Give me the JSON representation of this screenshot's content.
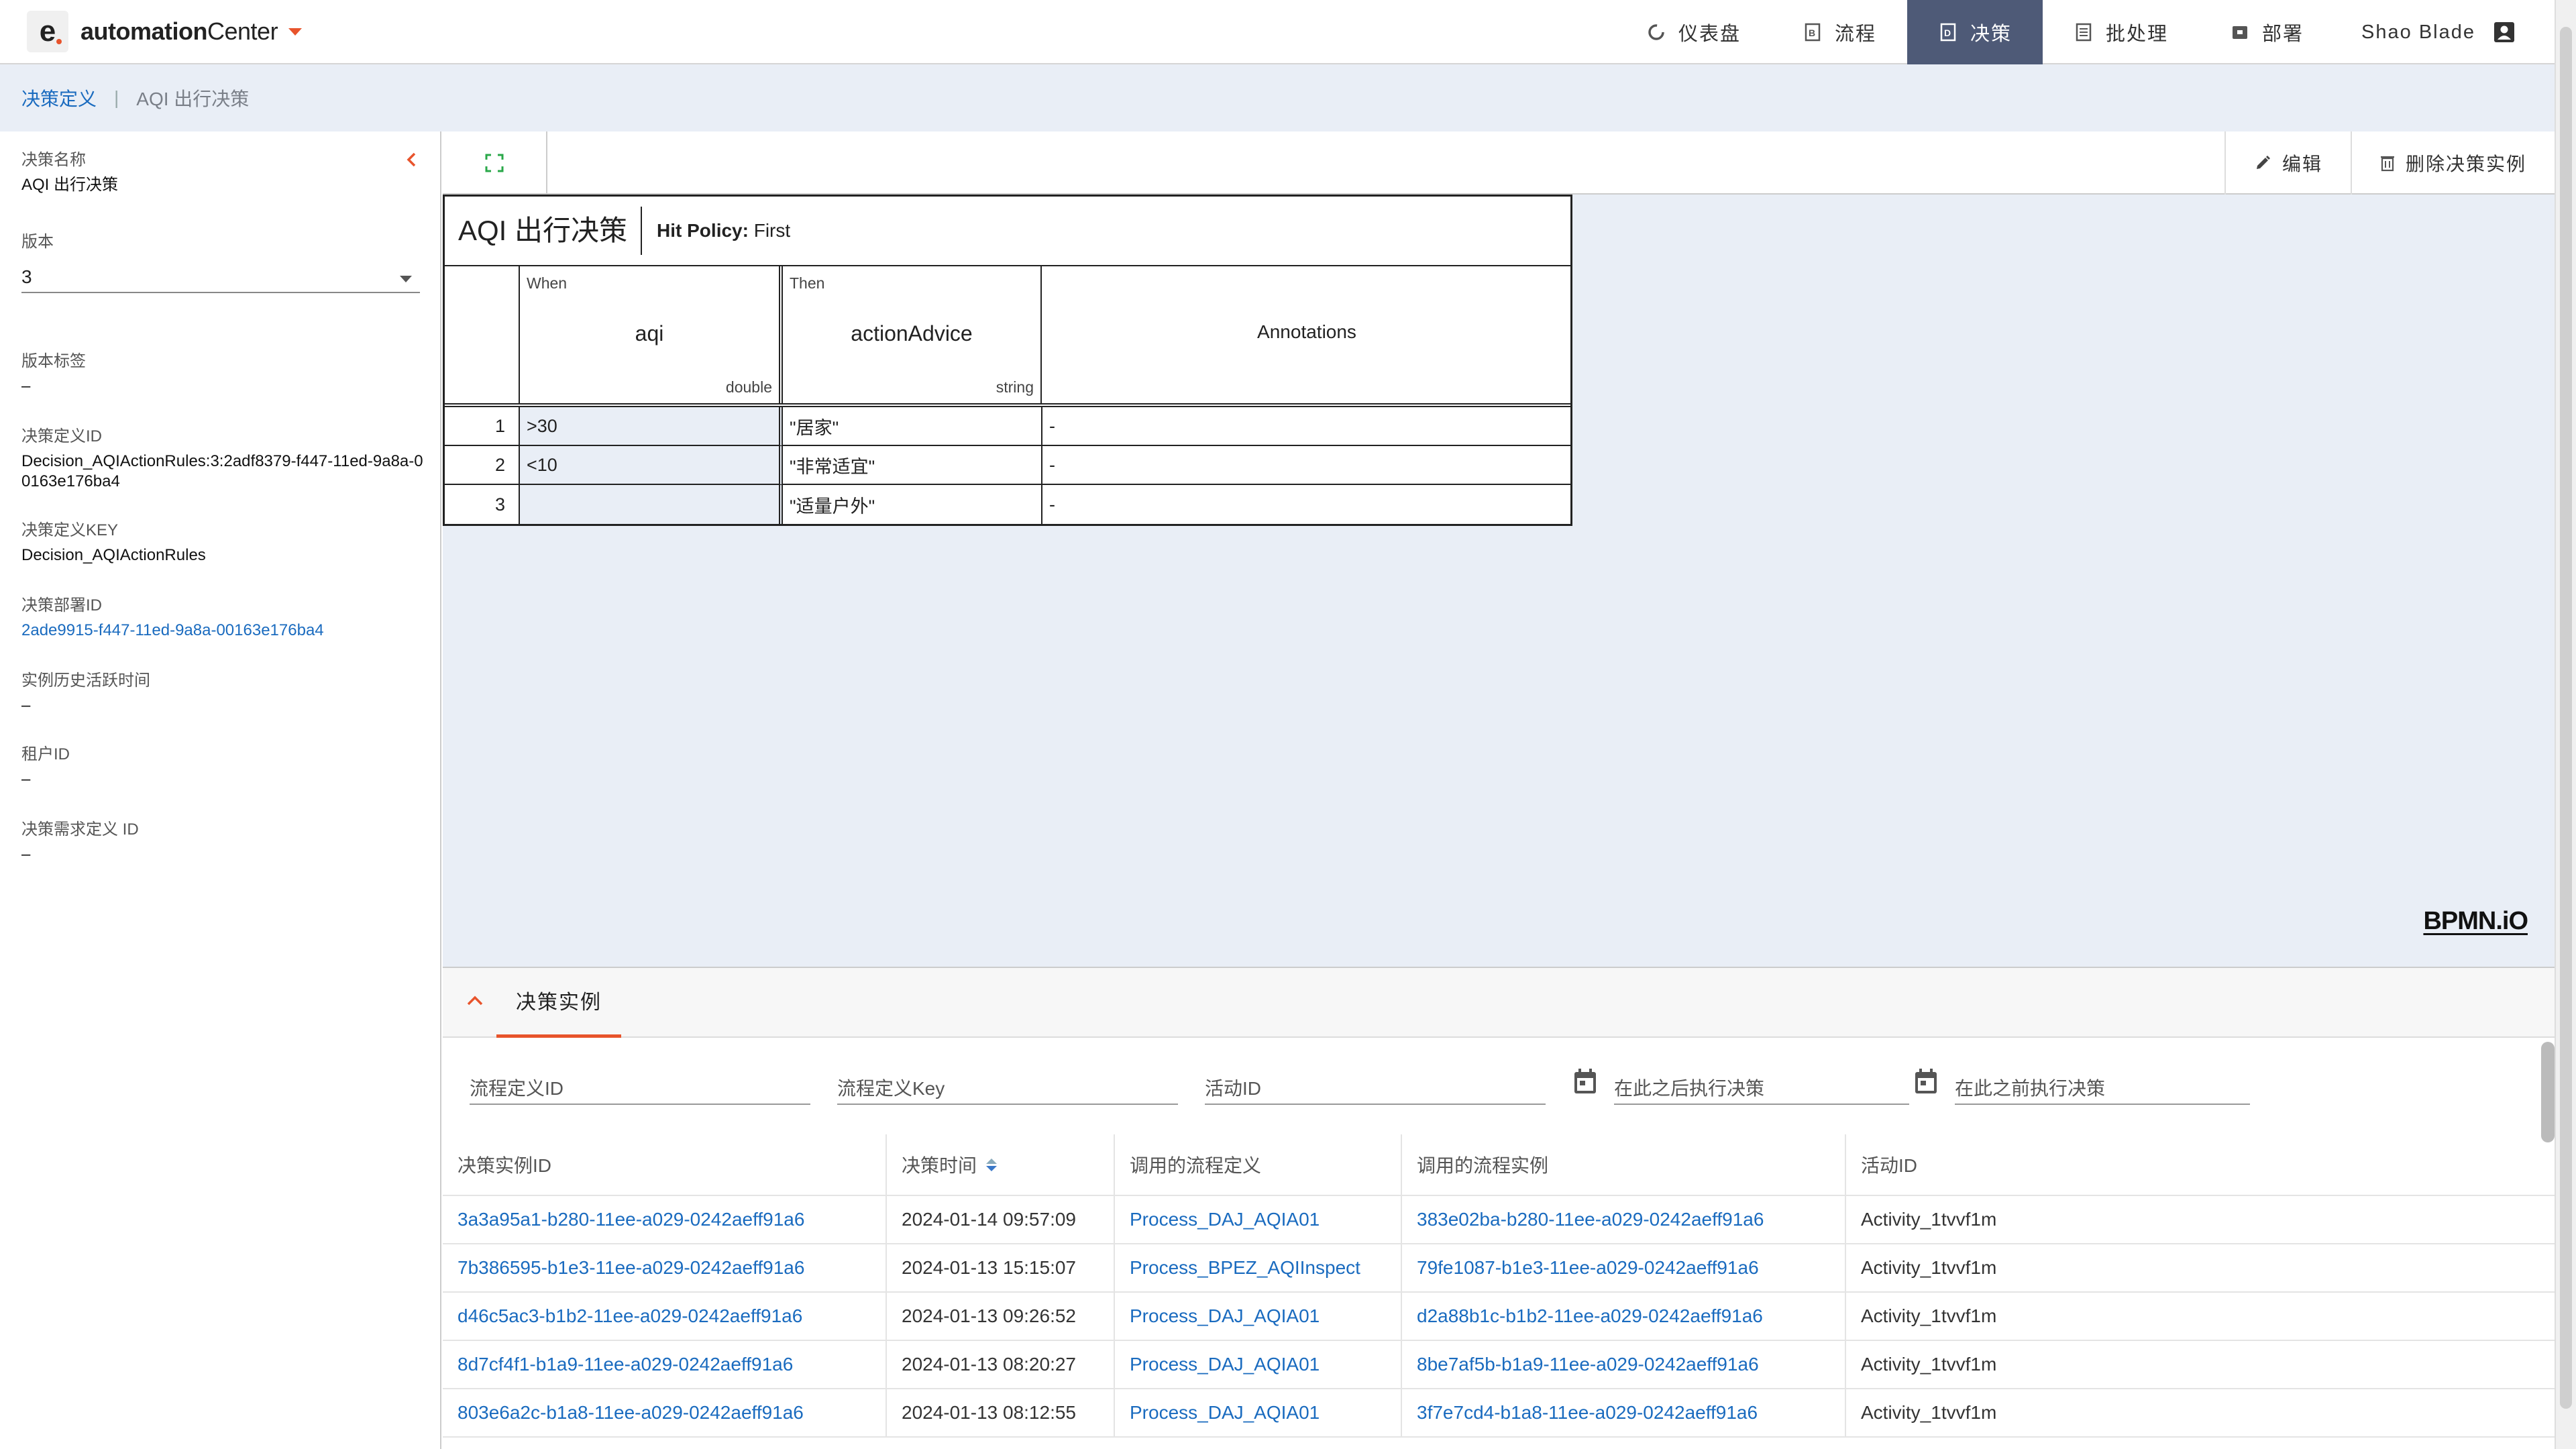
{
  "app": {
    "logo_letter": "e",
    "brand_bold": "automation",
    "brand_rest": "Center"
  },
  "nav": {
    "items": [
      {
        "label": "仪表盘",
        "icon": "dashboard-icon"
      },
      {
        "label": "流程",
        "icon": "process-icon"
      },
      {
        "label": "决策",
        "icon": "decision-icon",
        "active": true
      },
      {
        "label": "批处理",
        "icon": "batch-icon"
      },
      {
        "label": "部署",
        "icon": "deploy-icon"
      }
    ],
    "user": "Shao Blade"
  },
  "breadcrumb": {
    "parent": "决策定义",
    "separator": "|",
    "current": "AQI 出行决策"
  },
  "details": {
    "decision_name_label": "决策名称",
    "decision_name": "AQI 出行决策",
    "version_label": "版本",
    "version": "3",
    "version_tag_label": "版本标签",
    "version_tag": "–",
    "definition_id_label": "决策定义ID",
    "definition_id": "Decision_AQIActionRules:3:2adf8379-f447-11ed-9a8a-00163e176ba4",
    "definition_key_label": "决策定义KEY",
    "definition_key": "Decision_AQIActionRules",
    "deployment_id_label": "决策部署ID",
    "deployment_id": "2ade9915-f447-11ed-9a8a-00163e176ba4",
    "history_ttl_label": "实例历史活跃时间",
    "history_ttl": "–",
    "tenant_label": "租户ID",
    "tenant": "–",
    "drd_label": "决策需求定义 ID",
    "drd": "–"
  },
  "toolbar": {
    "edit_label": "编辑",
    "delete_label": "删除决策实例"
  },
  "dmn": {
    "title": "AQI 出行决策",
    "hit_policy_label": "Hit Policy:",
    "hit_policy": "First",
    "input": {
      "kind": "When",
      "name": "aqi",
      "type": "double"
    },
    "output": {
      "kind": "Then",
      "name": "actionAdvice",
      "type": "string"
    },
    "annotations_label": "Annotations",
    "rules": [
      {
        "n": "1",
        "input": ">30",
        "output": "\"居家\"",
        "annotation": "-"
      },
      {
        "n": "2",
        "input": "<10",
        "output": "\"非常适宜\"",
        "annotation": "-"
      },
      {
        "n": "3",
        "input": "",
        "output": "\"适量户外\"",
        "annotation": "-"
      }
    ],
    "watermark": "BPMN.iO"
  },
  "instances": {
    "tab_label": "决策实例",
    "filters": {
      "process_def_id": "流程定义ID",
      "process_def_key": "流程定义Key",
      "activity_id": "活动ID",
      "executed_after": "在此之后执行决策",
      "executed_before": "在此之前执行决策"
    },
    "columns": [
      "决策实例ID",
      "决策时间",
      "调用的流程定义",
      "调用的流程实例",
      "活动ID"
    ],
    "rows": [
      {
        "id": "3a3a95a1-b280-11ee-a029-0242aeff91a6",
        "time": "2024-01-14 09:57:09",
        "proc_def": "Process_DAJ_AQIA01",
        "proc_inst": "383e02ba-b280-11ee-a029-0242aeff91a6",
        "activity": "Activity_1tvvf1m"
      },
      {
        "id": "7b386595-b1e3-11ee-a029-0242aeff91a6",
        "time": "2024-01-13 15:15:07",
        "proc_def": "Process_BPEZ_AQIInspect",
        "proc_inst": "79fe1087-b1e3-11ee-a029-0242aeff91a6",
        "activity": "Activity_1tvvf1m"
      },
      {
        "id": "d46c5ac3-b1b2-11ee-a029-0242aeff91a6",
        "time": "2024-01-13 09:26:52",
        "proc_def": "Process_DAJ_AQIA01",
        "proc_inst": "d2a88b1c-b1b2-11ee-a029-0242aeff91a6",
        "activity": "Activity_1tvvf1m"
      },
      {
        "id": "8d7cf4f1-b1a9-11ee-a029-0242aeff91a6",
        "time": "2024-01-13 08:20:27",
        "proc_def": "Process_DAJ_AQIA01",
        "proc_inst": "8be7af5b-b1a9-11ee-a029-0242aeff91a6",
        "activity": "Activity_1tvvf1m"
      },
      {
        "id": "803e6a2c-b1a8-11ee-a029-0242aeff91a6",
        "time": "2024-01-13 08:12:55",
        "proc_def": "Process_DAJ_AQIA01",
        "proc_inst": "3f7e7cd4-b1a8-11ee-a029-0242aeff91a6",
        "activity": "Activity_1tvvf1m"
      }
    ]
  },
  "colors": {
    "accent": "#e8542c",
    "nav_active": "#4e5a77",
    "link": "#1a6bbf",
    "canvas_bg": "#e9eef6"
  }
}
